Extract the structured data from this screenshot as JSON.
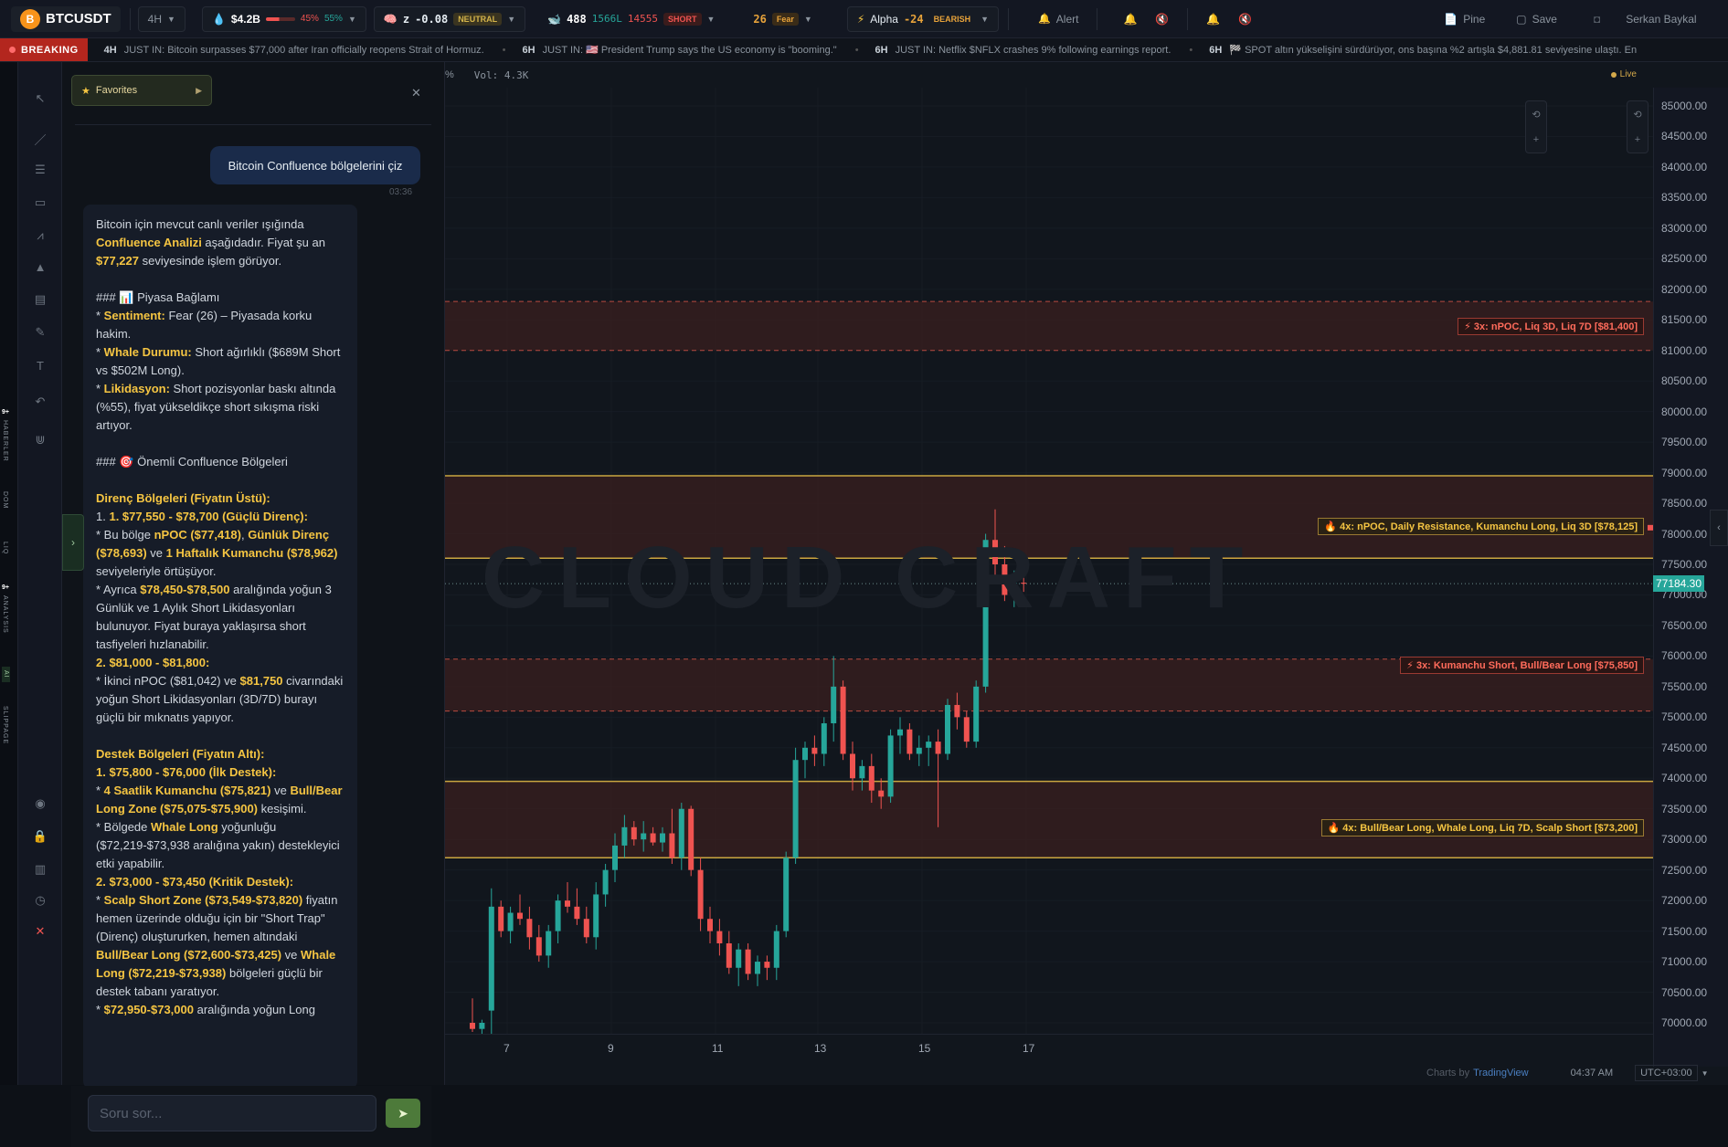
{
  "topbar": {
    "symbol": "BTCUSDT",
    "symbol_logo": "B",
    "timeframe": "4H",
    "liquidity_value": "$4.2B",
    "liquidity_long_pct": "45%",
    "liquidity_short_pct": "55%",
    "z_label": "z",
    "z_value": "-0.08",
    "z_tag": "NEUTRAL",
    "whale_count": "488",
    "whale_long": "1566L",
    "whale_short_count": "14555",
    "whale_tag": "SHORT",
    "fear_value": "26",
    "fear_tag": "Fear",
    "alpha_label": "Alpha",
    "alpha_value": "-24",
    "alpha_tag": "BEARISH",
    "alert_label": "Alert",
    "pine_label": "Pine",
    "save_label": "Save",
    "user_name": "Serkan Baykal"
  },
  "breaking": {
    "label": "BREAKING",
    "items": [
      {
        "age": "4H",
        "text": "JUST IN: Bitcoin surpasses $77,000 after Iran officially reopens Strait of Hormuz."
      },
      {
        "age": "6H",
        "text": "JUST IN: 🇺🇸 President Trump says the US economy is \"booming.\""
      },
      {
        "age": "6H",
        "text": "JUST IN: Netflix $NFLX crashes 9% following earnings report."
      },
      {
        "age": "6H",
        "text": "🏁 SPOT altın yükselişini sürdürüyor, ons başına %2 artışla $4,881.81 seviyesine ulaştı. En"
      }
    ]
  },
  "rail": {
    "labels": [
      "HABERLER",
      "DOM",
      "LIQ",
      "ANALYSIS",
      "AI",
      "SLIPPAGE"
    ],
    "badges": [
      "9+",
      "9+"
    ]
  },
  "panel": {
    "favorites_label": "Favorites",
    "user_message": "Bitcoin Confluence bölgelerini çiz",
    "user_time": "03:36",
    "input_placeholder": "Soru sor...",
    "ai": {
      "intro_a": "Bitcoin için mevcut canlı veriler ışığında ",
      "intro_hl": "Confluence Analizi",
      "intro_b": " aşağıdadır. Fiyat şu an ",
      "intro_price": "$77,227",
      "intro_c": " seviyesinde işlem görüyor.",
      "h_context": "### 📊 Piyasa Bağlamı",
      "sent_k": "Sentiment:",
      "sent_v": " Fear (26) – Piyasada korku hakim.",
      "whale_k": "Whale Durumu:",
      "whale_v": " Short ağırlıklı ($689M Short vs $502M Long).",
      "liq_k": "Likidasyon:",
      "liq_v": " Short pozisyonlar baskı altında (%55), fiyat yükseldikçe short sıkışma riski artıyor.",
      "h_zones": "### 🎯 Önemli Confluence Bölgeleri",
      "res_h": "Direnç Bölgeleri (Fiyatın Üstü):",
      "r1": "1. $77,550 - $78,700 (Güçlü Direnç):",
      "r1a": "* Bu bölge ",
      "r1b": "nPOC ($77,418)",
      "r1c": ", ",
      "r1d": "Günlük Direnç ($78,693)",
      "r1e": " ve ",
      "r1f": "1 Haftalık Kumanchu ($78,962)",
      "r1g": " seviyeleriyle örtüşüyor.",
      "r1h": "* Ayrıca ",
      "r1i": "$78,450-$78,500",
      "r1j": " aralığında yoğun 3 Günlük ve 1 Aylık Short Likidasyonları bulunuyor. Fiyat buraya yaklaşırsa short tasfiyeleri hızlanabilir.",
      "r2": "2. $81,000 - $81,800:",
      "r2a": "* İkinci nPOC ($81,042) ve ",
      "r2b": "$81,750",
      "r2c": " civarındaki yoğun Short Likidasyonları (3D/7D) burayı güçlü bir mıknatıs yapıyor.",
      "sup_h": "Destek Bölgeleri (Fiyatın Altı):",
      "s1": "1. $75,800 - $76,000 (İlk Destek):",
      "s1a": "* ",
      "s1b": "4 Saatlik Kumanchu ($75,821)",
      "s1c": " ve ",
      "s1d": "Bull/Bear Long Zone ($75,075-$75,900)",
      "s1e": " kesişimi.",
      "s1f": "* Bölgede ",
      "s1g": "Whale Long",
      "s1h": " yoğunluğu ($72,219-$73,938 aralığına yakın) destekleyici etki yapabilir.",
      "s2": "2. $73,000 - $73,450 (Kritik Destek):",
      "s2a": "* ",
      "s2b": "Scalp Short Zone ($73,549-$73,820)",
      "s2c": " fiyatın hemen üzerinde olduğu için bir \"Short Trap\" (Direnç) oluştururken, hemen altındaki ",
      "s2d": "Bull/Bear Long ($72,600-$73,425)",
      "s2e": " ve ",
      "s2f": "Whale Long ($72,219-$73,938)",
      "s2g": " bölgeleri güçlü bir destek tabanı yaratıyor.",
      "s3a": "* ",
      "s3b": "$72,950-$73,000",
      "s3c": " aralığında yoğun Long"
    }
  },
  "chart": {
    "sub_left": "%",
    "vol": "Vol: 4.3K",
    "live": "Live",
    "watermark": "CLOUD CRAFT",
    "current_price": "77184.30",
    "price_ticks": [
      "85000.00",
      "84500.00",
      "84000.00",
      "83500.00",
      "83000.00",
      "82500.00",
      "82000.00",
      "81500.00",
      "81000.00",
      "80500.00",
      "80000.00",
      "79500.00",
      "79000.00",
      "78500.00",
      "78000.00",
      "77500.00",
      "77000.00",
      "76500.00",
      "76000.00",
      "75500.00",
      "75000.00",
      "74500.00",
      "74000.00",
      "73500.00",
      "73000.00",
      "72500.00",
      "72000.00",
      "71500.00",
      "71000.00",
      "70500.00",
      "70000.00"
    ],
    "time_ticks": [
      "7",
      "9",
      "11",
      "13",
      "15",
      "17"
    ],
    "zones": [
      {
        "label": "⚡ 3x: nPOC, Liq 3D, Liq 7D [$81,400]"
      },
      {
        "label": "🔥 4x: nPOC, Daily Resistance, Kumanchu Long, Liq 3D [$78,125]"
      },
      {
        "label": "⚡ 3x: Kumanchu Short, Bull/Bear Long [$75,850]"
      },
      {
        "label": "🔥 4x: Bull/Bear Long, Whale Long, Liq 7D, Scalp Short [$73,200]"
      }
    ],
    "footer_a": "Charts by",
    "footer_b": "TradingView",
    "clock": "04:37 AM",
    "tz": "UTC+03:00"
  },
  "colors": {
    "up": "#26a69a",
    "down": "#ef5350",
    "gold": "#f5c542",
    "zone": "#3a1f1f"
  }
}
